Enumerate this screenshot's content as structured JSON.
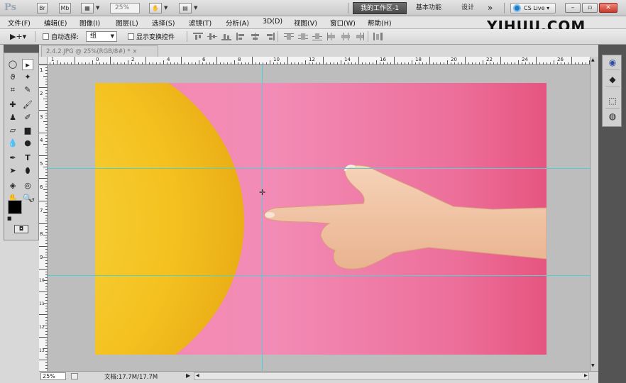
{
  "app": {
    "logo": "Ps",
    "mb_label": "Mb",
    "zoom": "25%"
  },
  "workspaces": {
    "active": "我的工作区-1",
    "basic": "基本功能",
    "design": "设计",
    "more": "»",
    "cslive": "CS Live"
  },
  "window": {
    "minimize": "–",
    "restore": "▫",
    "close": "✕"
  },
  "menu": [
    "文件(F)",
    "编辑(E)",
    "图像(I)",
    "图层(L)",
    "选择(S)",
    "滤镜(T)",
    "分析(A)",
    "3D(D)",
    "视图(V)",
    "窗口(W)",
    "帮助(H)"
  ],
  "brand": {
    "main": "YIHUU",
    "suffix": ".COM"
  },
  "options": {
    "auto_select_label": "自动选择:",
    "auto_select_value": "组",
    "show_transform_label": "显示变换控件"
  },
  "document": {
    "tab_title": "2.4.2.JPG @ 25%(RGB/8#) *",
    "close": "×"
  },
  "ruler": {
    "h_ticks": [
      "1",
      "0",
      "2",
      "4",
      "6",
      "8",
      "10",
      "12",
      "14",
      "16",
      "18",
      "20",
      "22",
      "24",
      "26"
    ],
    "v_ticks": [
      "1",
      "2",
      "3",
      "4",
      "5",
      "6",
      "7",
      "8",
      "9",
      "10",
      "11",
      "12",
      "13"
    ]
  },
  "status": {
    "zoom": "25%",
    "doc_size": "文档:17.7M/17.7M"
  },
  "colors": {
    "accent_guide": "#4fd0d4",
    "photo_bg": "#f28bb5",
    "balloon": "#f5c51f",
    "skin": "#f1c3a6"
  }
}
